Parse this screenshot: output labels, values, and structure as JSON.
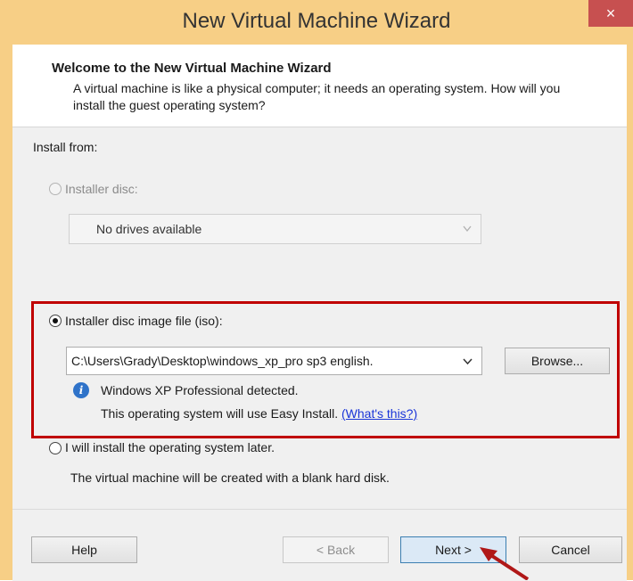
{
  "window": {
    "title": "New Virtual Machine Wizard",
    "close_symbol": "×"
  },
  "header": {
    "title": "Welcome to the New Virtual Machine Wizard",
    "description": "A virtual machine is like a physical computer; it needs an operating system. How will you install the guest operating system?"
  },
  "install": {
    "label": "Install from:",
    "disc": {
      "label": "Installer disc:",
      "selected": false,
      "enabled": false,
      "dropdown_value": "No drives available"
    },
    "iso": {
      "label": "Installer disc image file (iso):",
      "selected": true,
      "path": "C:\\Users\\Grady\\Desktop\\windows_xp_pro sp3 english.",
      "browse_label": "Browse...",
      "detected": "Windows XP Professional detected.",
      "easy_install_text": "This operating system will use Easy Install.",
      "whats_this": "(What's this?)"
    },
    "later": {
      "label": "I will install the operating system later.",
      "selected": false,
      "description": "The virtual machine will be created with a blank hard disk."
    }
  },
  "footer": {
    "help": "Help",
    "back": "< Back",
    "next": "Next >",
    "cancel": "Cancel"
  },
  "icons": {
    "dropdown": "chevron-down-icon",
    "info": "info-icon",
    "close": "close-icon"
  },
  "colors": {
    "title_bar": "#f7cf86",
    "highlight": "#c00000",
    "link": "#1a35d8",
    "close": "#c75050"
  }
}
